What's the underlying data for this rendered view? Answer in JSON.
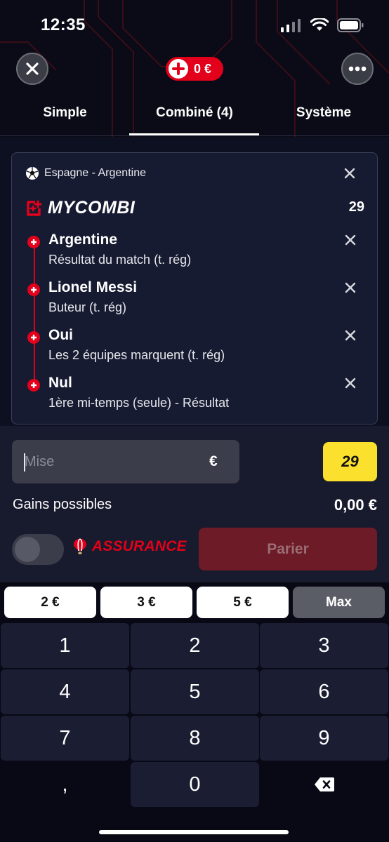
{
  "status_bar": {
    "time": "12:35"
  },
  "header": {
    "balance": "0 €",
    "close_icon": "close-icon",
    "more_icon": "more-dots-icon"
  },
  "tabs": [
    {
      "label": "Simple",
      "active": false
    },
    {
      "label": "Combiné (4)",
      "active": true
    },
    {
      "label": "Système",
      "active": false
    }
  ],
  "bet_card": {
    "match": "Espagne - Argentine",
    "brand": "MYCOMBI",
    "odds": "29",
    "selections": [
      {
        "name": "Argentine",
        "market": "Résultat du match (t. rég)"
      },
      {
        "name": "Lionel Messi",
        "market": "Buteur (t. rég)"
      },
      {
        "name": "Oui",
        "market": "Les 2 équipes marquent (t. rég)"
      },
      {
        "name": "Nul",
        "market": "1ère mi-temps (seule) - Résultat"
      }
    ]
  },
  "stake": {
    "placeholder": "Mise",
    "currency": "€",
    "odds_badge": "29"
  },
  "gains": {
    "label": "Gains possibles",
    "value": "0,00 €"
  },
  "insurance": {
    "label": "ASSURANCE",
    "enabled": false
  },
  "bet_button": {
    "label": "Parier"
  },
  "quick_amounts": [
    "2 €",
    "3 €",
    "5 €",
    "Max"
  ],
  "keypad": {
    "keys": [
      "1",
      "2",
      "3",
      "4",
      "5",
      "6",
      "7",
      "8",
      "9",
      ",",
      "0"
    ],
    "backspace_icon": "backspace-icon"
  },
  "colors": {
    "brand_red": "#e2001a",
    "odds_yellow": "#fbe12e",
    "background": "#0d1020",
    "card": "#171b31"
  }
}
